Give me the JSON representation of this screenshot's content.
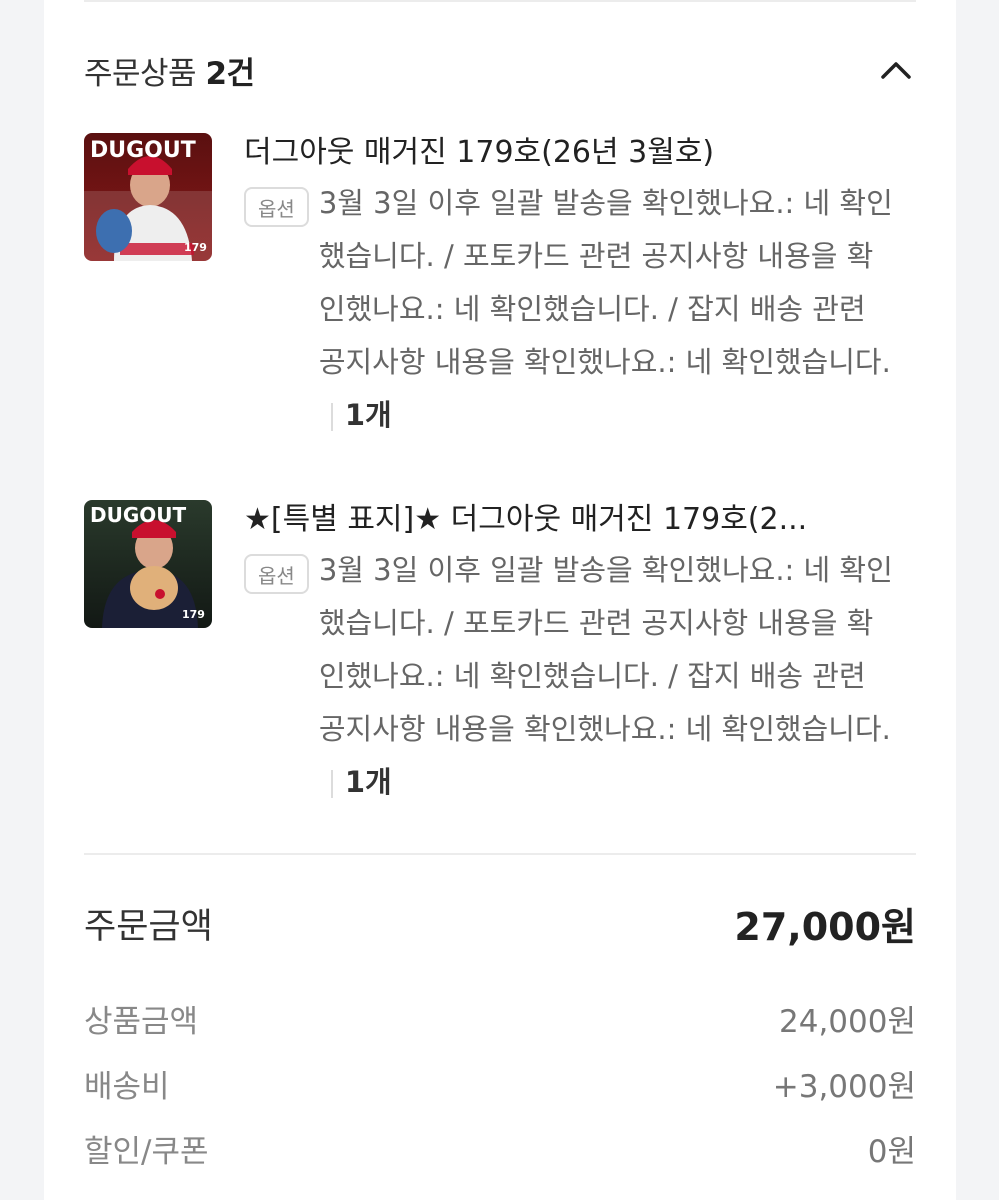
{
  "order_items": {
    "title": "주문상품",
    "count": "2건",
    "items": [
      {
        "title": "더그아웃 매거진 179호(26년 3월호)",
        "thumb_logo": "DUGOUT",
        "thumb_number": "179",
        "option_badge": "옵션",
        "option_text": "3월 3일 이후 일괄 발송을 확인했나요.: 네 확인했습니다. / 포토카드 관련 공지사항 내용을 확인했나요.: 네 확인했습니다. / 잡지 배송 관련 공지사항 내용을 확인했나요.: 네 확인했습니다.",
        "quantity": "1개"
      },
      {
        "title": "★[특별 표지]★ 더그아웃 매거진 179호(2...",
        "thumb_logo": "DUGOUT",
        "thumb_number": "179",
        "option_badge": "옵션",
        "option_text": "3월 3일 이후 일괄 발송을 확인했나요.: 네 확인했습니다. / 포토카드 관련 공지사항 내용을 확인했나요.: 네 확인했습니다. / 잡지 배송 관련 공지사항 내용을 확인했나요.: 네 확인했습니다.",
        "quantity": "1개"
      }
    ]
  },
  "summary": {
    "total_label": "주문금액",
    "total_value": "27,000원",
    "rows": [
      {
        "label": "상품금액",
        "value": "24,000원"
      },
      {
        "label": "배송비",
        "value": "+3,000원"
      },
      {
        "label": "할인/쿠폰",
        "value": "0원"
      }
    ]
  },
  "icons": {
    "collapse": "chevron-up-icon"
  }
}
